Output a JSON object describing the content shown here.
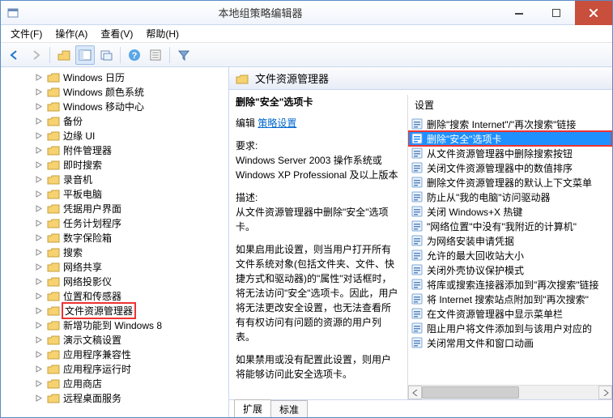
{
  "window": {
    "title": "本地组策略编辑器"
  },
  "menubar": {
    "file": "文件(F)",
    "action": "操作(A)",
    "view": "查看(V)",
    "help": "帮助(H)"
  },
  "tree": {
    "items": [
      {
        "label": "Windows 日历",
        "exp": true
      },
      {
        "label": "Windows 颜色系统",
        "exp": true
      },
      {
        "label": "Windows 移动中心",
        "exp": true
      },
      {
        "label": "备份",
        "exp": true
      },
      {
        "label": "边缘 UI",
        "exp": true
      },
      {
        "label": "附件管理器",
        "exp": true
      },
      {
        "label": "即时搜索",
        "exp": true
      },
      {
        "label": "录音机",
        "exp": true
      },
      {
        "label": "平板电脑",
        "exp": true
      },
      {
        "label": "凭据用户界面",
        "exp": true
      },
      {
        "label": "任务计划程序",
        "exp": true
      },
      {
        "label": "数字保险箱",
        "exp": true
      },
      {
        "label": "搜索",
        "exp": true
      },
      {
        "label": "网络共享",
        "exp": true
      },
      {
        "label": "网络投影仪",
        "exp": true
      },
      {
        "label": "位置和传感器",
        "exp": true
      },
      {
        "label": "文件资源管理器",
        "exp": true,
        "highlight": true
      },
      {
        "label": "新增功能到 Windows 8",
        "exp": true
      },
      {
        "label": "演示文稿设置",
        "exp": true
      },
      {
        "label": "应用程序兼容性",
        "exp": true
      },
      {
        "label": "应用程序运行时",
        "exp": true
      },
      {
        "label": "应用商店",
        "exp": true
      },
      {
        "label": "远程桌面服务",
        "exp": true
      }
    ]
  },
  "header": {
    "title": "文件资源管理器"
  },
  "desc": {
    "title": "删除\"安全\"选项卡",
    "edit_label": "编辑",
    "edit_link": "策略设置",
    "req_label": "要求:",
    "req_text": "Windows Server 2003 操作系统或 Windows XP Professional 及以上版本",
    "desc_label": "描述:",
    "desc_text": "从文件资源管理器中删除\"安全\"选项卡。",
    "para1": "如果启用此设置，则当用户打开所有文件系统对象(包括文件夹、文件、快捷方式和驱动器)的\"属性\"对话框时，将无法访问\"安全\"选项卡。因此，用户将无法更改安全设置，也无法查看所有有权访问有问题的资源的用户列表。",
    "para2": "如果禁用或没有配置此设置，则用户将能够访问此安全选项卡。"
  },
  "settings": {
    "header": "设置",
    "items": [
      {
        "label": "删除\"搜索 Internet\"/\"再次搜索\"链接"
      },
      {
        "label": "删除\"安全\"选项卡",
        "selected": true,
        "redbox": true
      },
      {
        "label": "从文件资源管理器中删除搜索按钮"
      },
      {
        "label": "关闭文件资源管理器中的数值排序"
      },
      {
        "label": "删除文件资源管理器的默认上下文菜单"
      },
      {
        "label": "防止从\"我的电脑\"访问驱动器"
      },
      {
        "label": "关闭 Windows+X 热键"
      },
      {
        "label": "\"网络位置\"中没有\"我附近的计算机\""
      },
      {
        "label": "为网络安装申请凭据"
      },
      {
        "label": "允许的最大回收站大小"
      },
      {
        "label": "关闭外壳协议保护模式"
      },
      {
        "label": "将库或搜索连接器添加到\"再次搜索\"链接"
      },
      {
        "label": "将 Internet 搜索站点附加到\"再次搜索\""
      },
      {
        "label": "在文件资源管理器中显示菜单栏"
      },
      {
        "label": "阻止用户将文件添加到与该用户对应的"
      },
      {
        "label": "关闭常用文件和窗口动画"
      }
    ]
  },
  "tabs": {
    "extended": "扩展",
    "standard": "标准"
  }
}
